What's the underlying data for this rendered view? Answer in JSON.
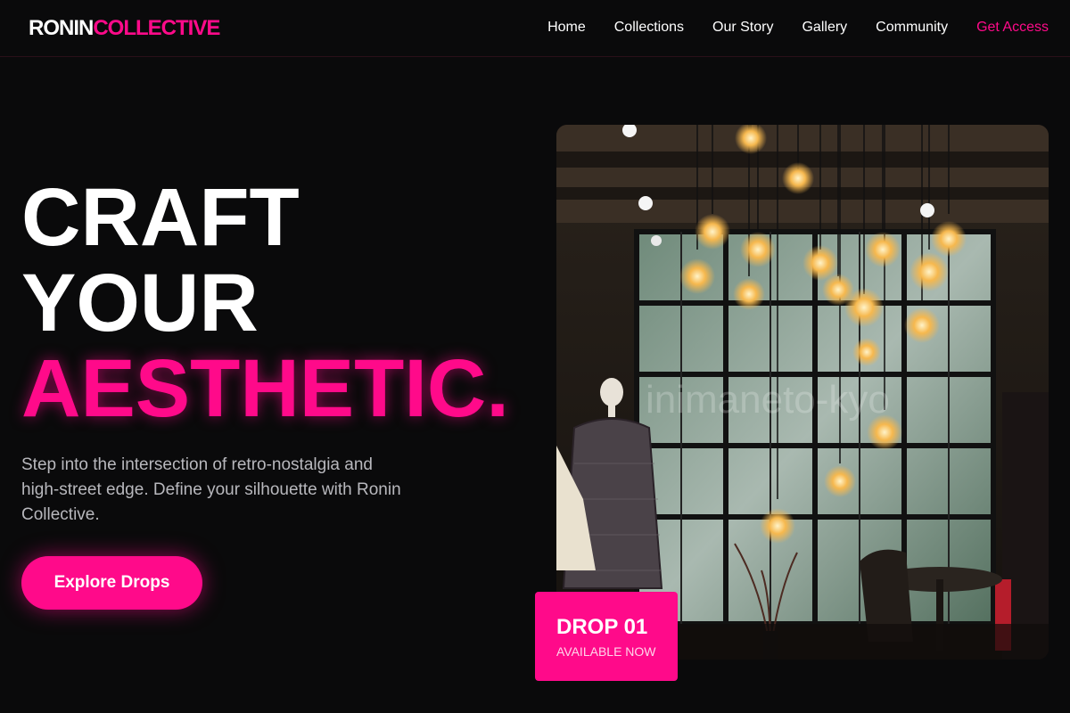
{
  "brand": {
    "part1": "RONIN",
    "part2": "COLLECTIVE"
  },
  "nav": {
    "items": [
      {
        "label": "Home"
      },
      {
        "label": "Collections"
      },
      {
        "label": "Our Story"
      },
      {
        "label": "Gallery"
      },
      {
        "label": "Community"
      }
    ],
    "cta_label": "Get Access"
  },
  "hero": {
    "line1": "CRAFT",
    "line2": "YOUR",
    "line3": "AESTHETIC.",
    "subtitle": "Step into the intersection of retro-nostalgia and high-street edge. Define your silhouette with Ronin Collective.",
    "button_label": "Explore Drops"
  },
  "feature_image": {
    "watermark": "inimaneto-kyo",
    "badge_title": "DROP 01",
    "badge_subtitle": "AVAILABLE NOW"
  },
  "colors": {
    "accent": "#ff0a8a",
    "background": "#0a0a0b",
    "text": "#ffffff",
    "muted": "#b8b8bd"
  }
}
